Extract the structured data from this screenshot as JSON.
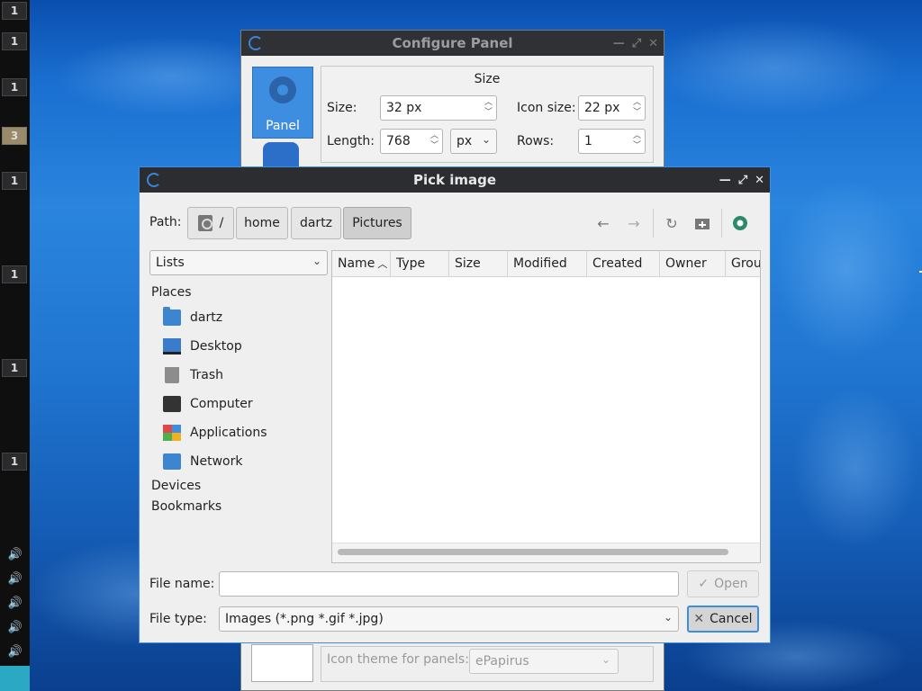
{
  "desktop": {
    "workspaces": [
      "1",
      "1",
      "1",
      "1",
      "1",
      "1"
    ],
    "folder_badge": "3"
  },
  "configure_panel": {
    "title": "Configure Panel",
    "sidebar": {
      "panel_label": "Panel"
    },
    "size_group": {
      "title": "Size",
      "size_label": "Size:",
      "size_value": "32 px",
      "icon_size_label": "Icon size:",
      "icon_size_value": "22 px",
      "length_label": "Length:",
      "length_value": "768",
      "length_unit": "px",
      "rows_label": "Rows:",
      "rows_value": "1"
    },
    "icon_theme_label": "Icon theme for panels:",
    "icon_theme_value": "ePapirus"
  },
  "pick_image": {
    "title": "Pick image",
    "path_label": "Path:",
    "crumbs": [
      "/",
      "home",
      "dartz",
      "Pictures"
    ],
    "places_view": "Lists",
    "places_heading": "Places",
    "places": [
      "dartz",
      "Desktop",
      "Trash",
      "Computer",
      "Applications",
      "Network"
    ],
    "devices_heading": "Devices",
    "bookmarks_heading": "Bookmarks",
    "columns": [
      "Name",
      "Type",
      "Size",
      "Modified",
      "Created",
      "Owner",
      "Grou"
    ],
    "file_name_label": "File name:",
    "file_name_value": "",
    "file_type_label": "File type:",
    "file_type_value": "Images (*.png *.gif *.jpg)",
    "open_label": "Open",
    "cancel_label": "Cancel"
  },
  "colors": {
    "accent": "#3d8ee0",
    "title_dark": "#2b2d31"
  }
}
